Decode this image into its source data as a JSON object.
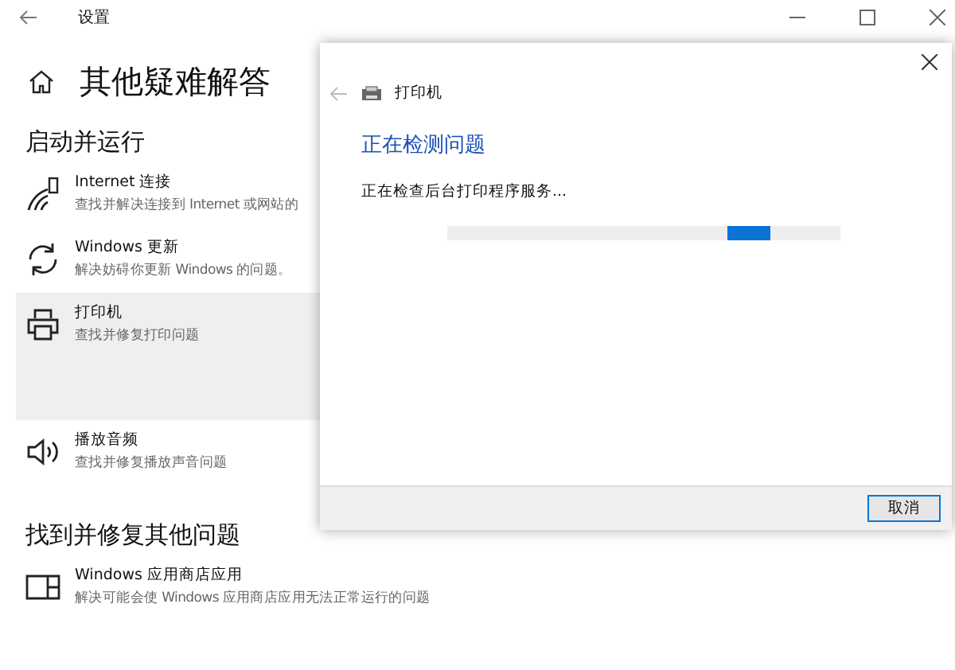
{
  "window": {
    "title": "设置"
  },
  "page": {
    "title": "其他疑难解答"
  },
  "sections": [
    {
      "heading": "启动并运行",
      "items": [
        {
          "kind": "wifi",
          "title": "Internet 连接",
          "description": "查找并解决连接到 Internet 或网站的",
          "selected": false
        },
        {
          "kind": "update",
          "title": "Windows 更新",
          "description": "解决妨碍你更新 Windows 的问题。",
          "selected": false
        },
        {
          "kind": "printer",
          "title": "打印机",
          "description": "查找并修复打印问题",
          "selected": true
        },
        {
          "kind": "audio",
          "title": "播放音频",
          "description": "查找并修复播放声音问题",
          "selected": false
        }
      ]
    },
    {
      "heading": "找到并修复其他问题",
      "items": [
        {
          "kind": "store",
          "title": "Windows 应用商店应用",
          "description": "解决可能会使 Windows 应用商店应用无法正常运行的问题",
          "selected": false
        }
      ]
    }
  ],
  "dialog": {
    "title": "打印机",
    "heading": "正在检测问题",
    "status": "正在检查后台打印程序服务...",
    "progress": {
      "level": 0.82
    },
    "buttons": [
      "取消"
    ]
  }
}
